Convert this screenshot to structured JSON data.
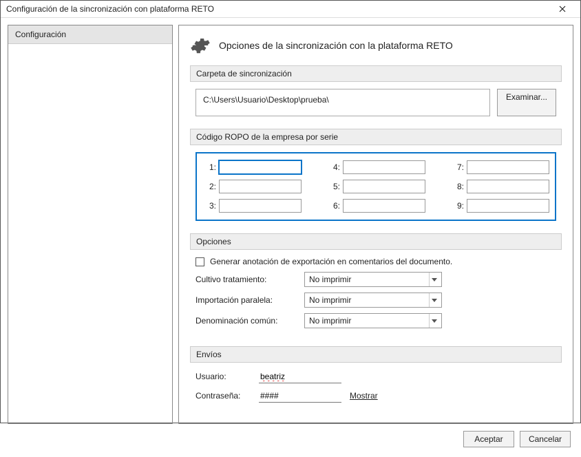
{
  "window": {
    "title": "Configuración de la sincronización con plataforma RETO"
  },
  "sidebar": {
    "items": [
      {
        "label": "Configuración"
      }
    ]
  },
  "main": {
    "title": "Opciones de la sincronización con la plataforma RETO",
    "folder": {
      "section_label": "Carpeta de sincronización",
      "path": "C:\\Users\\Usuario\\Desktop\\prueba\\",
      "browse_label": "Examinar..."
    },
    "ropo": {
      "section_label": "Código ROPO de la empresa por serie",
      "labels": [
        "1:",
        "2:",
        "3:",
        "4:",
        "5:",
        "6:",
        "7:",
        "8:",
        "9:"
      ],
      "values": [
        "",
        "",
        "",
        "",
        "",
        "",
        "",
        "",
        ""
      ]
    },
    "options": {
      "section_label": "Opciones",
      "checkbox_label": "Generar anotación de exportación en comentarios del documento.",
      "checkbox_checked": false,
      "rows": [
        {
          "label": "Cultivo tratamiento:",
          "value": "No imprimir"
        },
        {
          "label": "Importación paralela:",
          "value": "No imprimir"
        },
        {
          "label": "Denominación común:",
          "value": "No imprimir"
        }
      ]
    },
    "envios": {
      "section_label": "Envíos",
      "user_label": "Usuario:",
      "user_value": "beatriz",
      "pass_label": "Contraseña:",
      "pass_value": "####",
      "show_label": "Mostrar"
    }
  },
  "footer": {
    "accept": "Aceptar",
    "cancel": "Cancelar"
  }
}
